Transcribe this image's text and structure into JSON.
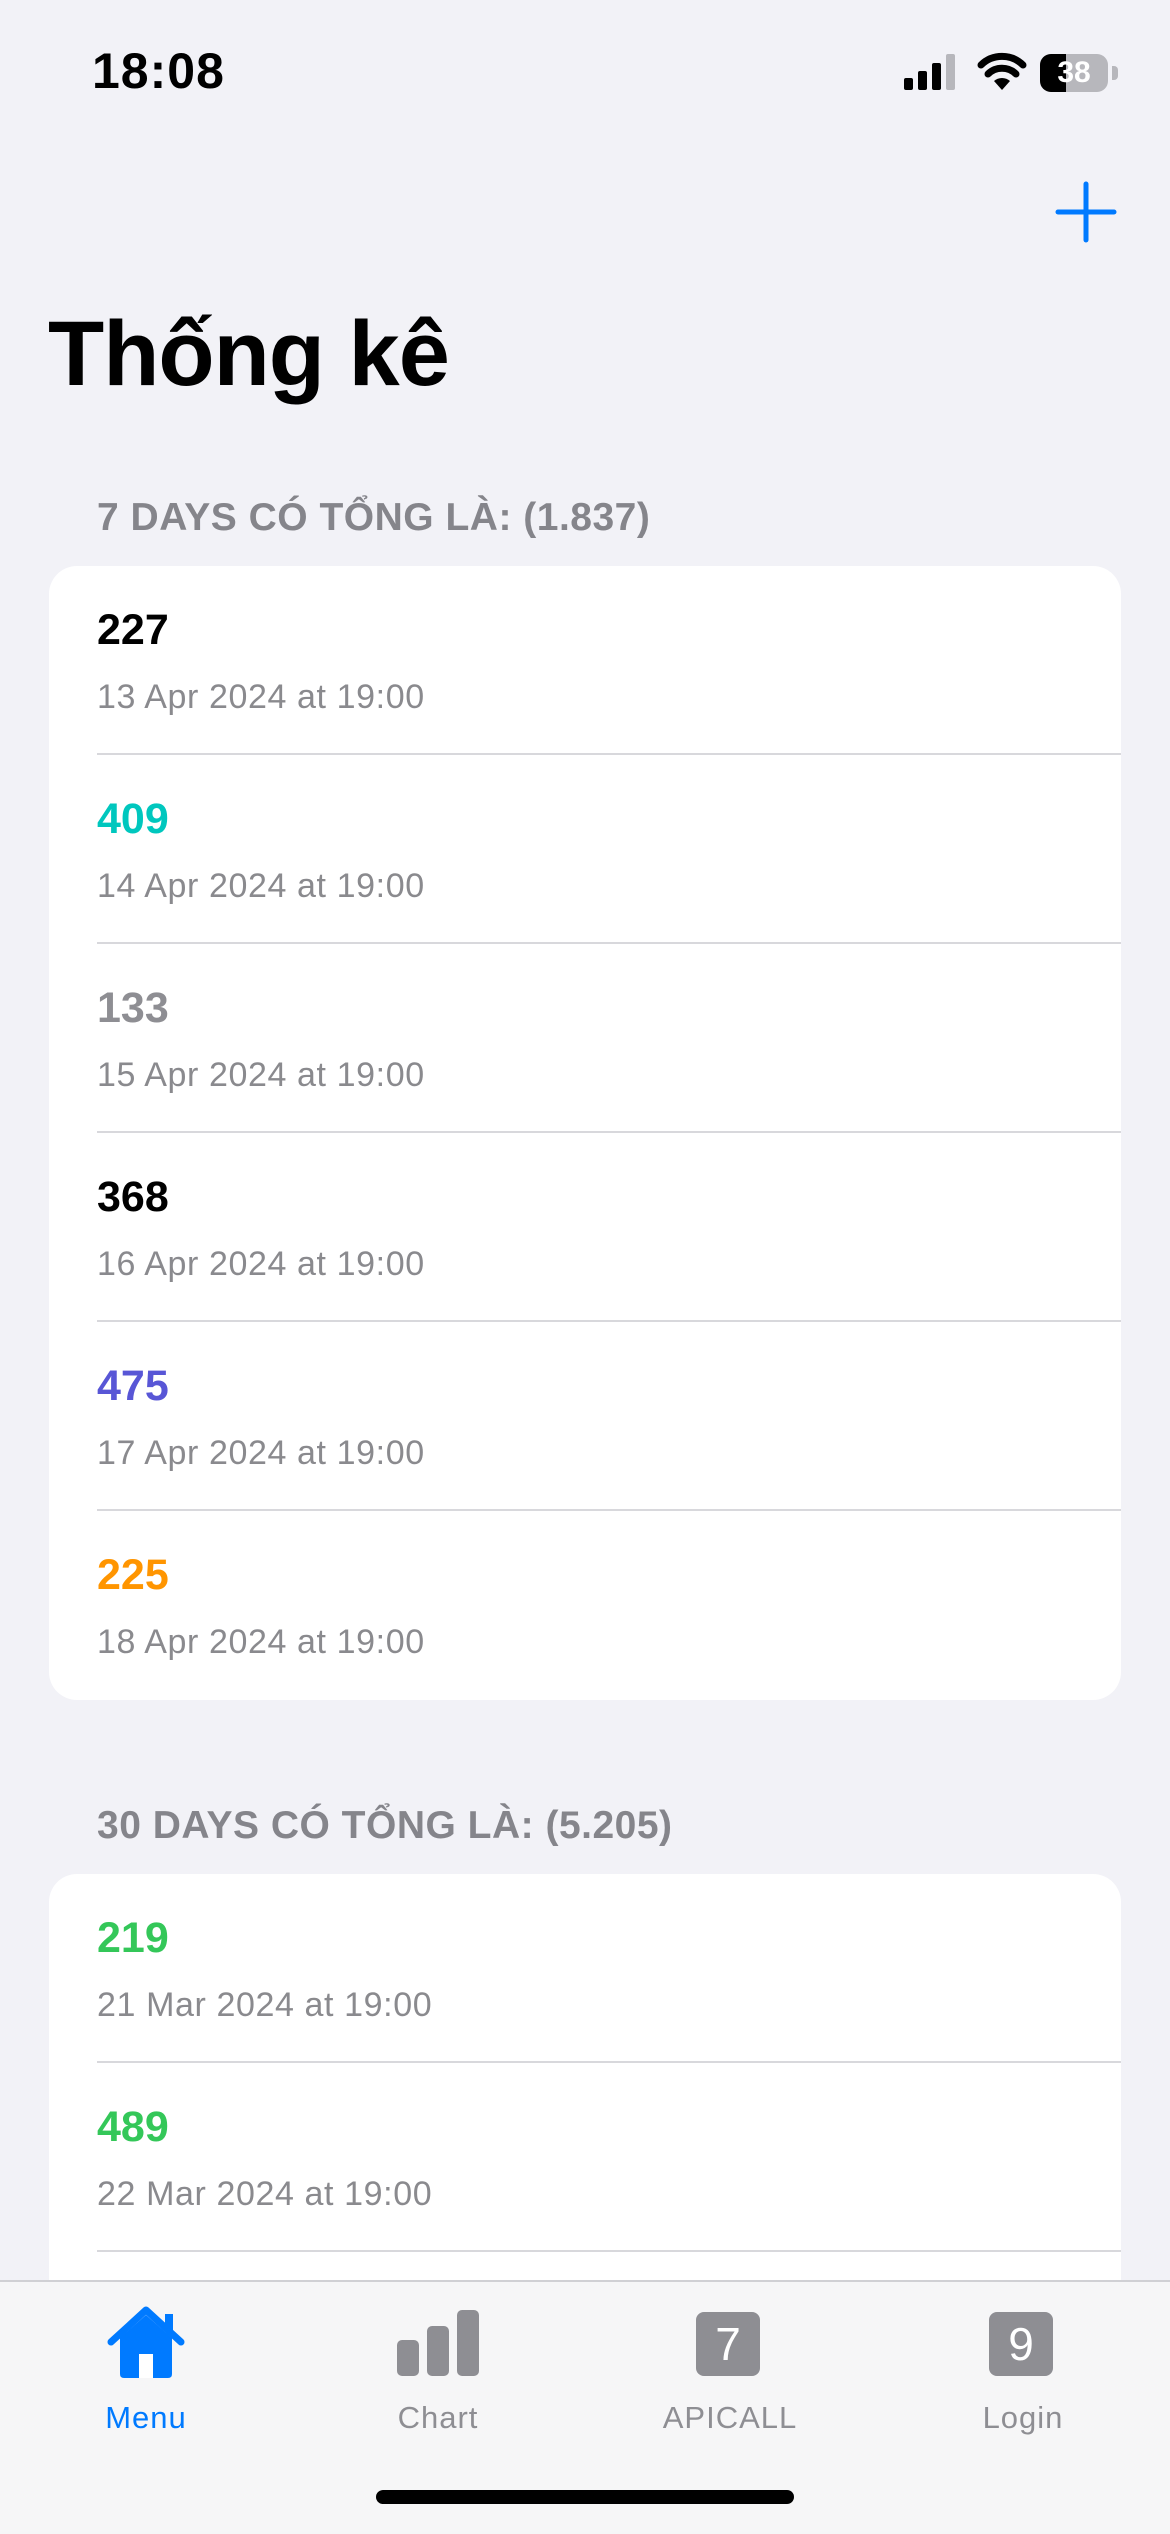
{
  "status_bar": {
    "time": "18:08",
    "battery": "38",
    "battery_level": 0.38
  },
  "navigation": {
    "title": "Thống kê",
    "add_icon": "plus-icon"
  },
  "sections": [
    {
      "header": "7 DAYS CÓ TỔNG LÀ: (1.837)",
      "rows": [
        {
          "value": "227",
          "date": "13 Apr 2024 at 19:00",
          "color": "#000000"
        },
        {
          "value": "409",
          "date": "14 Apr 2024 at 19:00",
          "color": "#00c7be"
        },
        {
          "value": "133",
          "date": "15 Apr 2024 at 19:00",
          "color": "#8e8e93"
        },
        {
          "value": "368",
          "date": "16 Apr 2024 at 19:00",
          "color": "#000000"
        },
        {
          "value": "475",
          "date": "17 Apr 2024 at 19:00",
          "color": "#5856d6"
        },
        {
          "value": "225",
          "date": "18 Apr 2024 at 19:00",
          "color": "#ff9500"
        }
      ]
    },
    {
      "header": "30 DAYS CÓ TỔNG LÀ: (5.205)",
      "rows": [
        {
          "value": "219",
          "date": "21 Mar 2024 at 19:00",
          "color": "#34c759"
        },
        {
          "value": "489",
          "date": "22 Mar 2024 at 19:00",
          "color": "#34c759"
        }
      ]
    }
  ],
  "tab_bar": {
    "active_color": "#007aff",
    "inactive_color": "#8e8e93",
    "tabs": [
      {
        "label": "Menu",
        "icon": "house-icon",
        "active": true
      },
      {
        "label": "Chart",
        "icon": "bar-chart-icon",
        "active": false
      },
      {
        "label": "APICALL",
        "icon": "7",
        "active": false
      },
      {
        "label": "Login",
        "icon": "9",
        "active": false
      }
    ]
  }
}
